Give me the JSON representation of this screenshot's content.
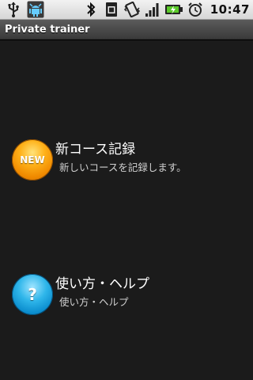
{
  "status_bar": {
    "time": "10:47",
    "icons": [
      "usb-icon",
      "android-debug-icon",
      "bluetooth-icon",
      "sim-icon",
      "vibrate-icon",
      "signal-icon",
      "battery-charging-icon",
      "alarm-icon"
    ]
  },
  "app": {
    "title": "Private trainer"
  },
  "menu": [
    {
      "orb_label": "NEW",
      "title": "新コース記録",
      "subtitle": "新しいコースを記録します。",
      "color": "#f39a0c"
    },
    {
      "orb_label": "?",
      "title": "使い方・ヘルプ",
      "subtitle": "使い方・ヘルプ",
      "color": "#1a9ad6"
    }
  ]
}
